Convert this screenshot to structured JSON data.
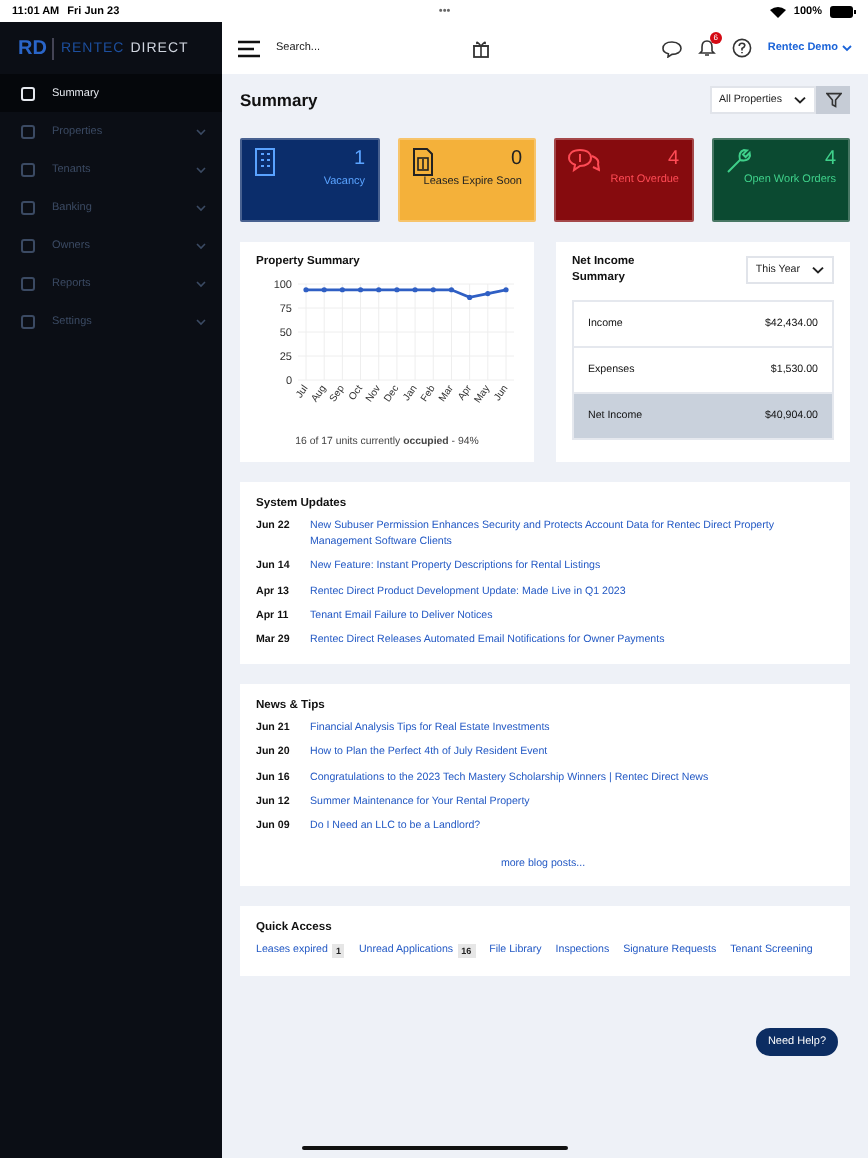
{
  "status_bar": {
    "time": "11:01 AM",
    "date": "Fri Jun 23",
    "dots": "•••",
    "battery": "100%"
  },
  "logo": {
    "mark": "RD",
    "name_a": "RENTEC",
    "name_b": "DIRECT"
  },
  "sidebar": {
    "items": [
      {
        "label": "Summary",
        "kind": "link",
        "selected": true
      },
      {
        "label": "Properties",
        "kind": "group",
        "selected": false
      },
      {
        "label": "Tenants",
        "kind": "group",
        "selected": false
      },
      {
        "label": "Banking",
        "kind": "group",
        "selected": false
      },
      {
        "label": "Owners",
        "kind": "group",
        "selected": false
      },
      {
        "label": "Reports",
        "kind": "group",
        "selected": false
      },
      {
        "label": "Settings",
        "kind": "group",
        "selected": false
      }
    ]
  },
  "header": {
    "search": {
      "placeholder": "Search..."
    },
    "notification_badge": "6",
    "user": "Rentec Demo"
  },
  "page_title": "Summary",
  "property_filter": "All Properties",
  "tiles": [
    {
      "kind": "building",
      "value": "1",
      "label": "Vacancy",
      "color": "#0b2d6b"
    },
    {
      "kind": "document",
      "value": "0",
      "label": "Leases Expire Soon",
      "color": "#f4b13a"
    },
    {
      "kind": "money",
      "value": "4",
      "label": "Rent Overdue",
      "color": "#860b0e"
    },
    {
      "kind": "wrench",
      "value": "4",
      "label": "Open Work Orders",
      "color": "#0b4a31"
    }
  ],
  "property_summary": {
    "title": "Property Summary",
    "chart_data": {
      "type": "line",
      "categories": [
        "Jul",
        "Aug",
        "Sep",
        "Oct",
        "Nov",
        "Dec",
        "Jan",
        "Feb",
        "Mar",
        "Apr",
        "May",
        "Jun"
      ],
      "ylim": [
        0,
        100
      ],
      "yticks": [
        0,
        25,
        50,
        75,
        100
      ],
      "grid": true,
      "series": [
        {
          "color": "#2f5fc4",
          "values": [
            94,
            94,
            94,
            94,
            94,
            94,
            94,
            94,
            94,
            86,
            90,
            94
          ]
        }
      ]
    },
    "caption_a": "16 of 17 units currently",
    "caption_b": "occupied",
    "caption_c": " - 94%"
  },
  "net_income": {
    "title": "Net Income Summary",
    "period": "This Year",
    "rows": [
      {
        "label": "Income",
        "value": "$42,434.00",
        "kind": "line"
      },
      {
        "label": "Expenses",
        "value": "$1,530.00",
        "kind": "line"
      },
      {
        "label": "Net Income",
        "value": "$40,904.00",
        "kind": "total"
      }
    ]
  },
  "system_updates": {
    "title": "System Updates",
    "items": [
      {
        "date": "Jun 22",
        "text": "New Subuser Permission Enhances Security and Protects Account Data for Rentec Direct Property Management Software Clients"
      },
      {
        "date": "Jun 14",
        "text": "New Feature: Instant Property Descriptions for Rental Listings"
      },
      {
        "date": "Apr 13",
        "text": "Rentec Direct Product Development Update: Made Live in Q1 2023"
      },
      {
        "date": "Apr 11",
        "text": "Tenant Email Failure to Deliver Notices"
      },
      {
        "date": "Mar 29",
        "text": "Rentec Direct Releases Automated Email Notifications for Owner Payments"
      }
    ]
  },
  "news": {
    "title": "News & Tips",
    "items": [
      {
        "date": "Jun 21",
        "text": "Financial Analysis Tips for Real Estate Investments"
      },
      {
        "date": "Jun 20",
        "text": "How to Plan the Perfect 4th of July Resident Event"
      },
      {
        "date": "Jun 16",
        "text": "Congratulations to the 2023 Tech Mastery Scholarship Winners | Rentec Direct News"
      },
      {
        "date": "Jun 12",
        "text": "Summer Maintenance for Your Rental Property"
      },
      {
        "date": "Jun 09",
        "text": "Do I Need an LLC to be a Landlord?"
      }
    ],
    "more": "more blog posts..."
  },
  "quick_access": {
    "title": "Quick Access",
    "links": [
      {
        "label": "Leases expired",
        "count": "1"
      },
      {
        "label": "Unread Applications",
        "count": "16"
      },
      {
        "label": "File Library"
      },
      {
        "label": "Inspections"
      },
      {
        "label": "Signature Requests"
      },
      {
        "label": "Tenant Screening"
      }
    ]
  },
  "help_button": "Need Help?"
}
